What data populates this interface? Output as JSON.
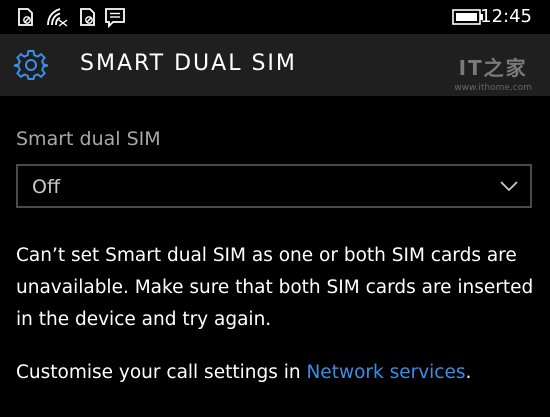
{
  "status_bar": {
    "time": "12:45",
    "icons": [
      "sim-no-signal-icon",
      "wifi-icon",
      "sim-no-signal-icon",
      "message-icon",
      "battery-icon"
    ]
  },
  "header": {
    "title": "SMART DUAL SIM",
    "icon": "gear-icon",
    "watermark_logo": "IT之家",
    "watermark_url": "www.ithome.com"
  },
  "settings": {
    "field_label": "Smart dual SIM",
    "dropdown_value": "Off",
    "message": "Can’t set Smart dual SIM as one or both SIM cards are unavailable. Make sure that both SIM cards are inserted in the device and try again.",
    "footer_prefix": "Customise your call settings in ",
    "footer_link": "Network services",
    "footer_suffix": "."
  },
  "colors": {
    "accent": "#3b8ee8",
    "header_bg": "#1f1f1f",
    "background": "#000000"
  }
}
